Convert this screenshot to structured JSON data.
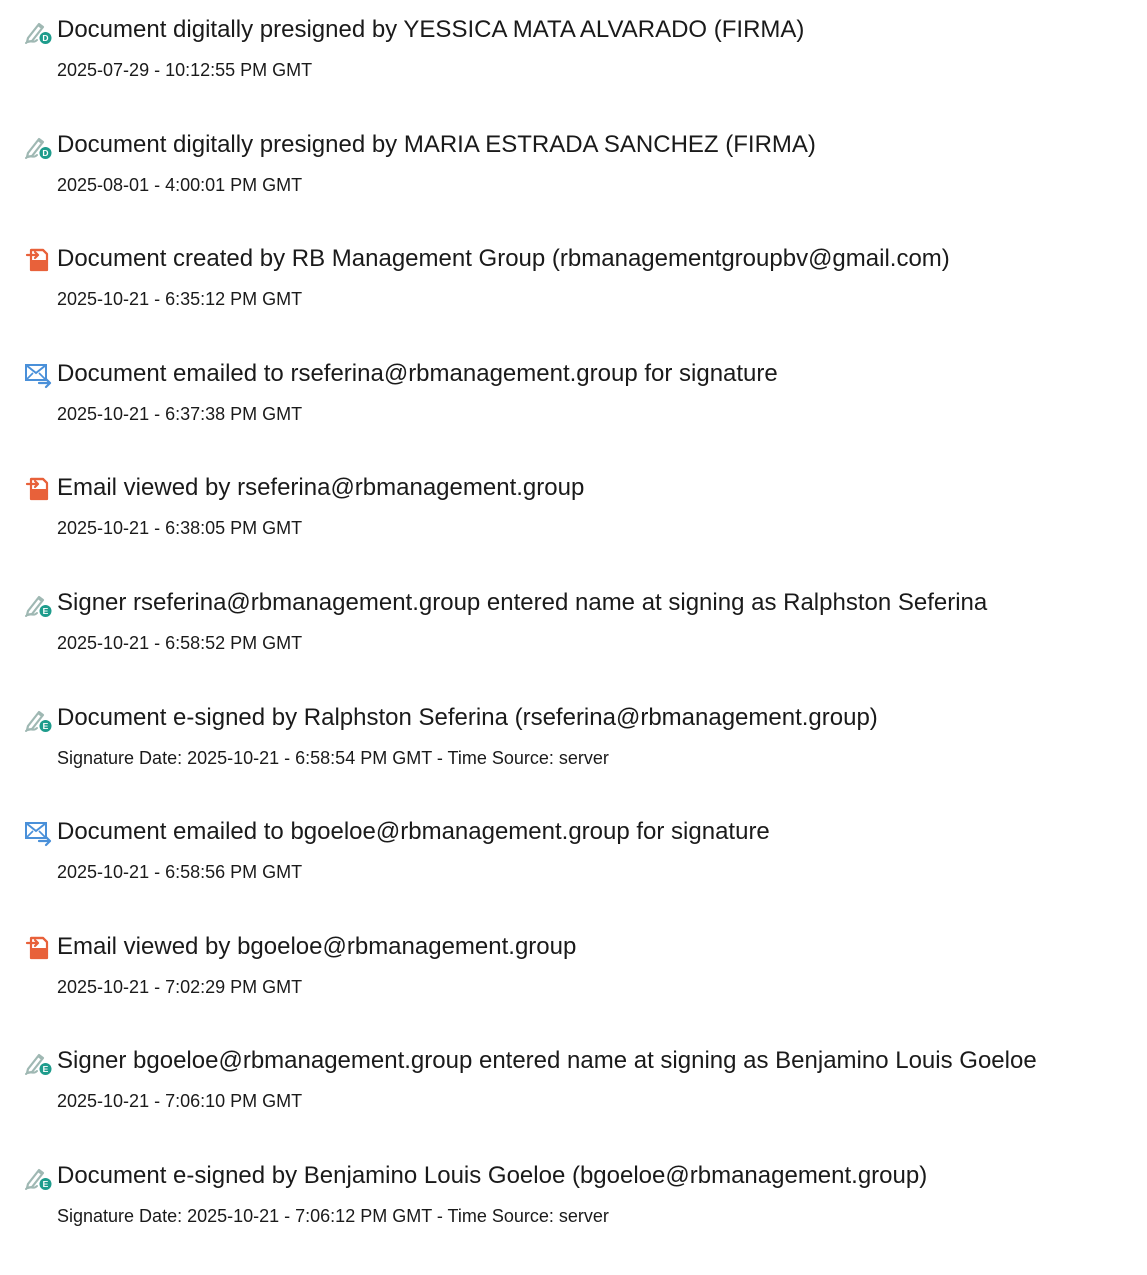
{
  "colors": {
    "sign_pen": "#9fb8b3",
    "sign_badge": "#1e9c8c",
    "created_icon": "#e8613a",
    "email_icon": "#4a90d9",
    "text": "#1a1a1a"
  },
  "events": [
    {
      "icon": "pen-signature-icon",
      "badge": "D",
      "title": "Document digitally presigned by YESSICA MATA ALVARADO (FIRMA)",
      "meta": "2025-07-29 - 10:12:55 PM GMT"
    },
    {
      "icon": "pen-signature-icon",
      "badge": "D",
      "title": "Document digitally presigned by MARIA ESTRADA SANCHEZ (FIRMA)",
      "meta": "2025-08-01 - 4:00:01 PM GMT"
    },
    {
      "icon": "document-created-icon",
      "title": "Document created by RB Management Group (rbmanagementgroupbv@gmail.com)",
      "meta": "2025-10-21 - 6:35:12 PM GMT"
    },
    {
      "icon": "email-sent-icon",
      "title": "Document emailed to rseferina@rbmanagement.group for signature",
      "meta": "2025-10-21 - 6:37:38 PM GMT"
    },
    {
      "icon": "document-created-icon",
      "title": "Email viewed by rseferina@rbmanagement.group",
      "meta": "2025-10-21 - 6:38:05 PM GMT"
    },
    {
      "icon": "pen-signature-icon",
      "badge": "E",
      "title": "Signer rseferina@rbmanagement.group entered name at signing as Ralphston Seferina",
      "meta": "2025-10-21 - 6:58:52 PM GMT"
    },
    {
      "icon": "pen-signature-icon",
      "badge": "E",
      "title": "Document e-signed by Ralphston Seferina (rseferina@rbmanagement.group)",
      "meta": "Signature Date: 2025-10-21 - 6:58:54 PM GMT - Time Source: server"
    },
    {
      "icon": "email-sent-icon",
      "title": "Document emailed to bgoeloe@rbmanagement.group for signature",
      "meta": "2025-10-21 - 6:58:56 PM GMT"
    },
    {
      "icon": "document-created-icon",
      "title": "Email viewed by bgoeloe@rbmanagement.group",
      "meta": "2025-10-21 - 7:02:29 PM GMT"
    },
    {
      "icon": "pen-signature-icon",
      "badge": "E",
      "title": "Signer bgoeloe@rbmanagement.group entered name at signing as Benjamino Louis Goeloe",
      "meta": "2025-10-21 - 7:06:10 PM GMT"
    },
    {
      "icon": "pen-signature-icon",
      "badge": "E",
      "title": "Document e-signed by Benjamino Louis Goeloe (bgoeloe@rbmanagement.group)",
      "meta": "Signature Date: 2025-10-21 - 7:06:12 PM GMT - Time Source: server"
    }
  ]
}
